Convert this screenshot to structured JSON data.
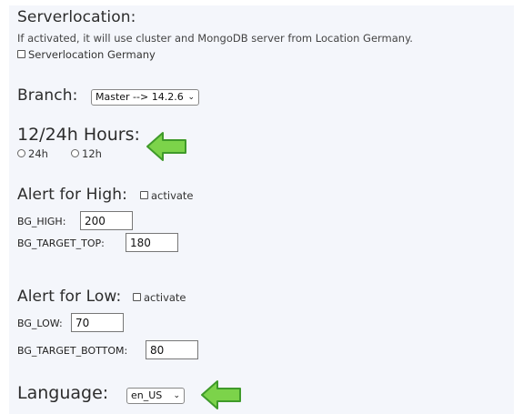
{
  "serverlocation": {
    "title": "Serverlocation:",
    "description": "If activated, it will use cluster and MongoDB server from Location Germany.",
    "checkbox_label": "Serverlocation Germany"
  },
  "branch": {
    "title": "Branch:",
    "selected": "Master --> 14.2.6"
  },
  "hours": {
    "title": "12/24h Hours:",
    "option_24": "24h",
    "option_12": "12h"
  },
  "alert_high": {
    "title": "Alert for High:",
    "activate_label": "activate",
    "bg_high_label": "BG_HIGH:",
    "bg_high_value": "200",
    "bg_target_top_label": "BG_TARGET_TOP:",
    "bg_target_top_value": "180"
  },
  "alert_low": {
    "title": "Alert for Low:",
    "activate_label": "activate",
    "bg_low_label": "BG_LOW:",
    "bg_low_value": "70",
    "bg_target_bottom_label": "BG_TARGET_BOTTOM:",
    "bg_target_bottom_value": "80"
  },
  "language": {
    "title": "Language:",
    "selected": "en_US"
  },
  "colors": {
    "arrow_fill": "#7cd34a",
    "arrow_stroke": "#3f9a2a",
    "panel_bg": "#f4f6fb"
  },
  "icons": {
    "dropdown": "chevron-down-icon",
    "annotation": "green-arrow-left-icon"
  }
}
